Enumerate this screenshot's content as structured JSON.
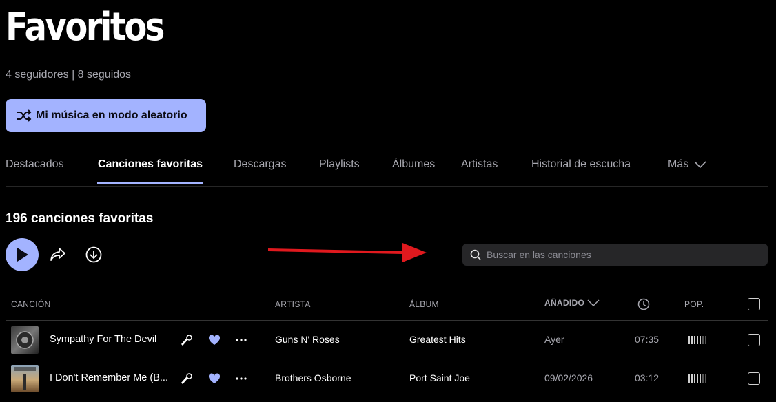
{
  "header": {
    "title": "Favoritos",
    "followers": "4 seguidores | 8 seguidos",
    "shuffle_label": "Mi música en modo aleatorio"
  },
  "tabs": [
    {
      "label": "Destacados"
    },
    {
      "label": "Canciones favoritas",
      "active": true
    },
    {
      "label": "Descargas"
    },
    {
      "label": "Playlists"
    },
    {
      "label": "Álbumes"
    },
    {
      "label": "Artistas"
    },
    {
      "label": "Historial de escucha"
    },
    {
      "label": "Más"
    }
  ],
  "section": {
    "count_label": "196 canciones favoritas",
    "search_placeholder": "Buscar en las canciones"
  },
  "table": {
    "columns": {
      "song": "CANCIÓN",
      "artist": "ARTISTA",
      "album": "ÁLBUM",
      "added": "AÑADIDO",
      "popularity": "POP."
    },
    "rows": [
      {
        "title": "Sympathy For The Devil",
        "artist": "Guns N' Roses",
        "album": "Greatest Hits",
        "added": "Ayer",
        "duration": "07:35",
        "popularity": 0.71
      },
      {
        "title": "I Don't Remember Me (B...",
        "artist": "Brothers Osborne",
        "album": "Port Saint Joe",
        "added": "09/02/2026",
        "duration": "03:12",
        "popularity": 0.71
      }
    ]
  },
  "colors": {
    "accent": "#a3b3ff",
    "background": "#000000",
    "muted_text": "#a8a8b0",
    "annotation_arrow": "#e0191e"
  }
}
